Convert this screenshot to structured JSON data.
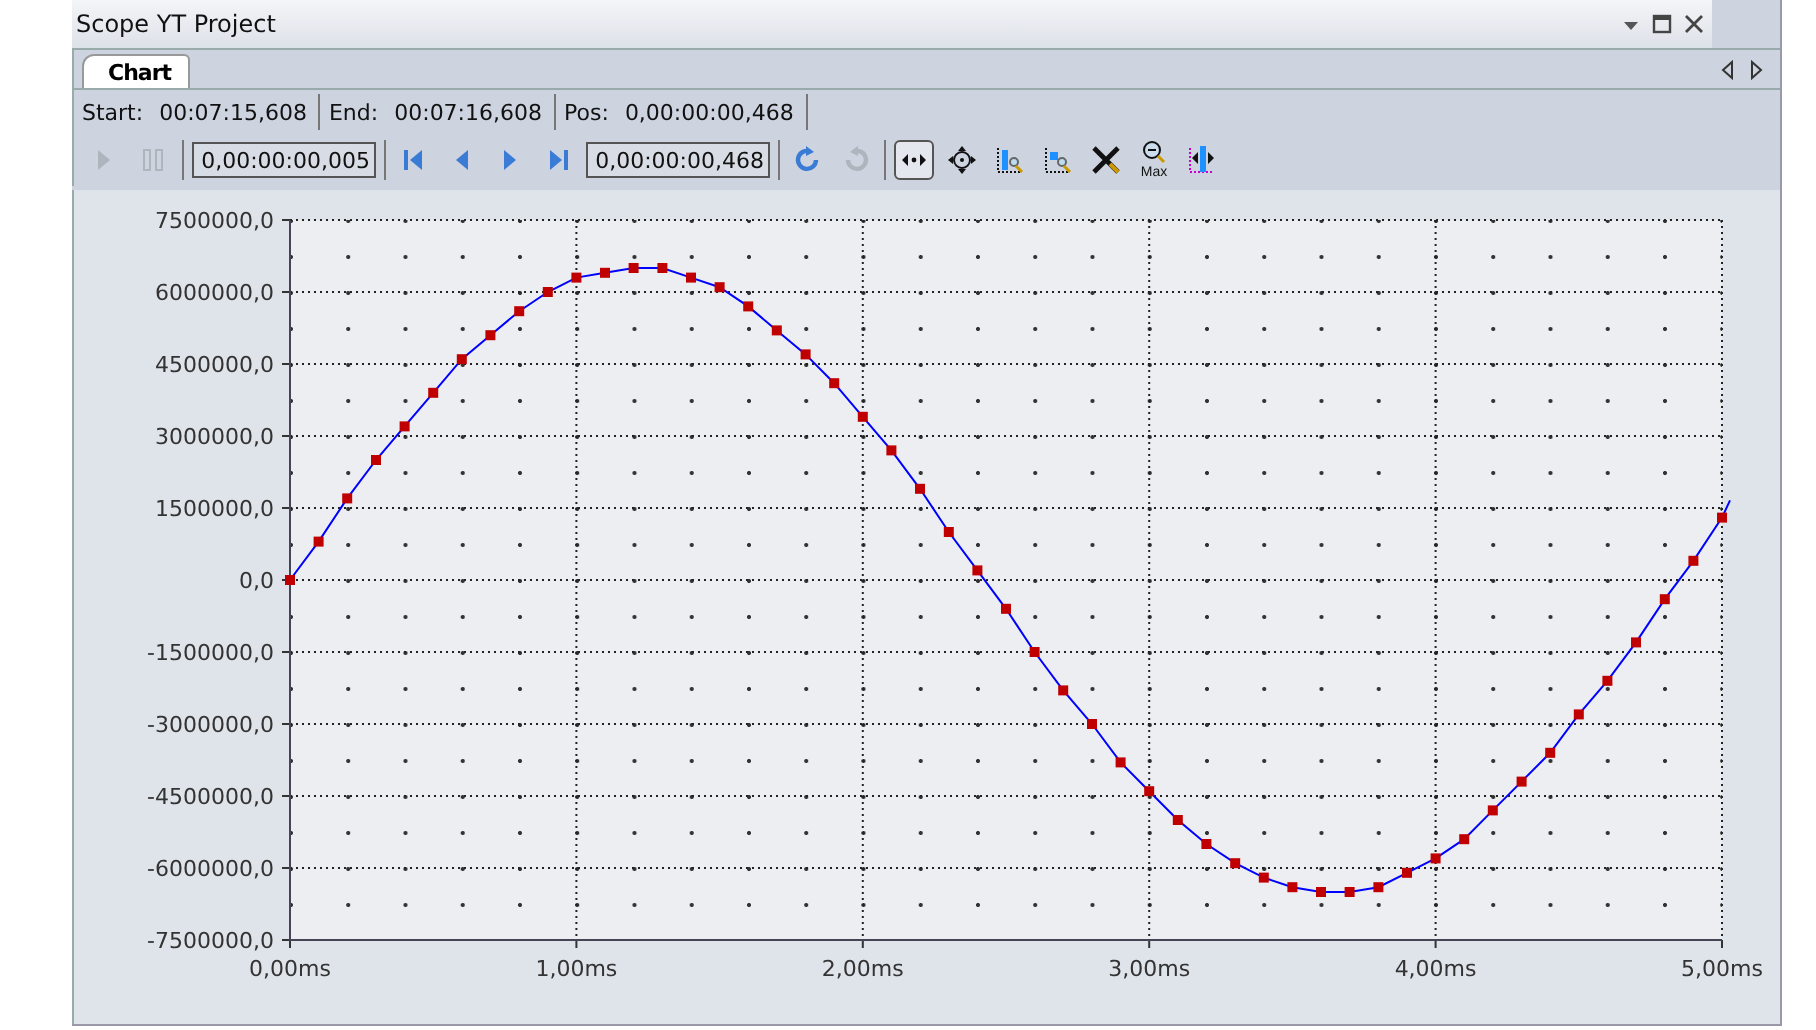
{
  "window": {
    "title": "Scope YT Project"
  },
  "tabs": [
    {
      "label": "Chart",
      "selected": true
    }
  ],
  "info": [
    {
      "label": "Start:",
      "value": "00:07:15,608"
    },
    {
      "label": "End:",
      "value": "00:07:16,608"
    },
    {
      "label": "Pos:",
      "value": "0,00:00:00,468"
    }
  ],
  "toolbar": [
    {
      "kind": "play",
      "disabled": true,
      "selected": false
    },
    {
      "kind": "pause",
      "disabled": true,
      "selected": false
    },
    {
      "kind": "separator"
    },
    {
      "kind": "field",
      "value": "0,00:00:00,005"
    },
    {
      "kind": "separator"
    },
    {
      "kind": "first",
      "disabled": false,
      "selected": false
    },
    {
      "kind": "prev",
      "disabled": false,
      "selected": false
    },
    {
      "kind": "next",
      "disabled": false,
      "selected": false
    },
    {
      "kind": "last",
      "disabled": false,
      "selected": false
    },
    {
      "kind": "field",
      "value": "0,00:00:00,468"
    },
    {
      "kind": "separator"
    },
    {
      "kind": "refresh",
      "disabled": false,
      "selected": false
    },
    {
      "kind": "redo",
      "disabled": true,
      "selected": false
    },
    {
      "kind": "separator"
    },
    {
      "kind": "pan-x",
      "disabled": false,
      "selected": true
    },
    {
      "kind": "pan",
      "disabled": false,
      "selected": false
    },
    {
      "kind": "zoom-y",
      "disabled": false,
      "selected": false
    },
    {
      "kind": "zoom-box",
      "disabled": false,
      "selected": false
    },
    {
      "kind": "tools",
      "disabled": false,
      "selected": false
    },
    {
      "kind": "zoom-max",
      "label": "Max",
      "disabled": false,
      "selected": false
    },
    {
      "kind": "cursor",
      "disabled": false,
      "selected": false
    }
  ],
  "chart_data": {
    "type": "line",
    "x": [
      0,
      0.1,
      0.2,
      0.3,
      0.4,
      0.5,
      0.6,
      0.7,
      0.8,
      0.9,
      1,
      1.1,
      1.2,
      1.3,
      1.4,
      1.5,
      1.6,
      1.7,
      1.8,
      1.9,
      2,
      2.1,
      2.2,
      2.3,
      2.4,
      2.5,
      2.6,
      2.7,
      2.8,
      2.9,
      3,
      3.1,
      3.2,
      3.3,
      3.4,
      3.5,
      3.6,
      3.7,
      3.8,
      3.9,
      4,
      4.1,
      4.2,
      4.3,
      4.4,
      4.5,
      4.6,
      4.7,
      4.8,
      4.9,
      5
    ],
    "grid": true,
    "series": [
      {
        "color": "#0000ff",
        "marker": "square",
        "values": [
          0,
          800000,
          1700000,
          2500000,
          3200000,
          3900000,
          4600000,
          5100000,
          5600000,
          6000000,
          6300000,
          6400000,
          6500000,
          6500000,
          6300000,
          6100000,
          5700000,
          5200000,
          4700000,
          4100000,
          3400000,
          2700000,
          1900000,
          1000000,
          200000,
          -600000,
          -1500000,
          -2300000,
          -3000000,
          -3800000,
          -4400000,
          -5000000,
          -5500000,
          -5900000,
          -6200000,
          -6400000,
          -6500000,
          -6500000,
          -6400000,
          -6100000,
          -5800000,
          -5400000,
          -4800000,
          -4200000,
          -3600000,
          -2800000,
          -2100000,
          -1300000,
          -400000,
          400000,
          1300000
        ]
      }
    ],
    "xlim": [
      0,
      5
    ],
    "ylim": [
      -7500000,
      7500000
    ],
    "xticks": [
      {
        "value": 0,
        "label": "0,00ms"
      },
      {
        "value": 1,
        "label": "1,00ms"
      },
      {
        "value": 2,
        "label": "2,00ms"
      },
      {
        "value": 3,
        "label": "3,00ms"
      },
      {
        "value": 4,
        "label": "4,00ms"
      },
      {
        "value": 5,
        "label": "5,00ms"
      }
    ],
    "yticks": [
      {
        "value": 7500000,
        "label": "7500000,0"
      },
      {
        "value": 6000000,
        "label": "6000000,0"
      },
      {
        "value": 4500000,
        "label": "4500000,0"
      },
      {
        "value": 3000000,
        "label": "3000000,0"
      },
      {
        "value": 1500000,
        "label": "1500000,0"
      },
      {
        "value": 0,
        "label": "0,0"
      },
      {
        "value": -1500000,
        "label": "-1500000,0"
      },
      {
        "value": -3000000,
        "label": "-3000000,0"
      },
      {
        "value": -4500000,
        "label": "-4500000,0"
      },
      {
        "value": -6000000,
        "label": "-6000000,0"
      },
      {
        "value": -7500000,
        "label": "-7500000,0"
      }
    ]
  }
}
